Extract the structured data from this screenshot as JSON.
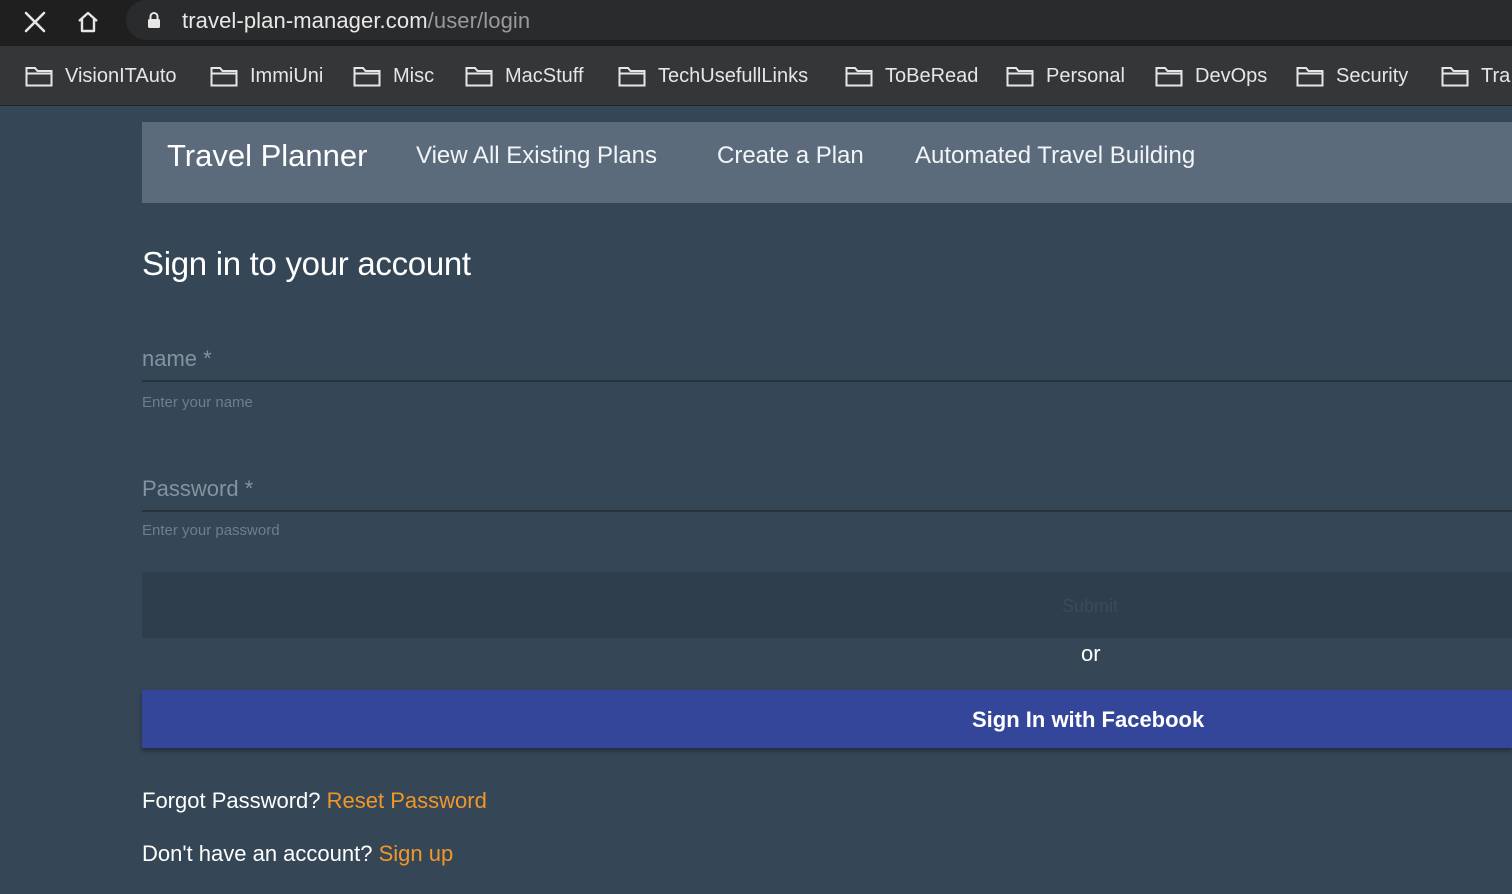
{
  "browser": {
    "url_host": "travel-plan-manager.com",
    "url_path": "/user/login",
    "close_icon": "close-icon",
    "home_icon": "home-icon",
    "lock_icon": "lock-icon",
    "bookmarks": [
      {
        "label": "VisionITAuto",
        "icon": "folder-icon"
      },
      {
        "label": "ImmiUni",
        "icon": "folder-icon"
      },
      {
        "label": "Misc",
        "icon": "folder-icon"
      },
      {
        "label": "MacStuff",
        "icon": "folder-icon"
      },
      {
        "label": "TechUsefullLinks",
        "icon": "folder-icon"
      },
      {
        "label": "ToBeRead",
        "icon": "folder-icon"
      },
      {
        "label": "Personal",
        "icon": "folder-icon"
      },
      {
        "label": "DevOps",
        "icon": "folder-icon"
      },
      {
        "label": "Security",
        "icon": "folder-icon"
      },
      {
        "label": "Tra",
        "icon": "folder-icon"
      }
    ]
  },
  "navbar": {
    "brand": "Travel Planner",
    "links": [
      "View All Existing Plans",
      "Create a Plan",
      "Automated Travel Building"
    ]
  },
  "login": {
    "title": "Sign in to your account",
    "name_label": "name *",
    "name_helper": "Enter your name",
    "password_label": "Password *",
    "password_helper": "Enter your password",
    "submit_label": "Submit",
    "or_text": "or",
    "facebook_label": "Sign In with Facebook",
    "forgot_text": "Forgot Password?",
    "reset_link": "Reset Password",
    "no_account_text": "Don't have an account?",
    "signup_link": "Sign up"
  },
  "colors": {
    "page_bg": "#354656",
    "navbar_bg": "#5b6b7b",
    "facebook_button": "#33469a",
    "link_accent": "#f0962b"
  }
}
